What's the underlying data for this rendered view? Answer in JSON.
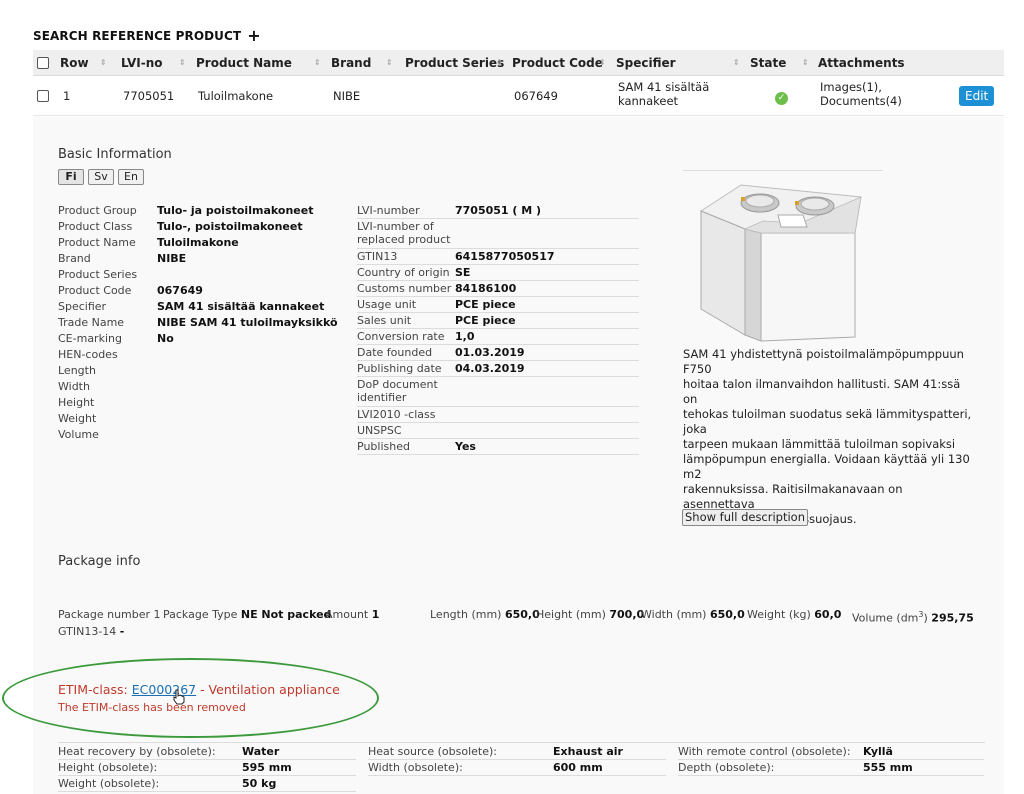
{
  "title": "SEARCH REFERENCE PRODUCT",
  "title_add": "+",
  "table": {
    "headers": [
      "Row",
      "LVI-no",
      "Product Name",
      "Brand",
      "Product Series",
      "Product Code",
      "Specifier",
      "State",
      "Attachments"
    ],
    "sort_glyph": "⇕",
    "row": {
      "row": "1",
      "lvi": "7705051",
      "name": "Tuloilmakone",
      "brand": "NIBE",
      "series": "",
      "code": "067649",
      "specifier_1": "SAM 41 sisältää",
      "specifier_2": "kannakeet",
      "state_glyph": "✓",
      "attach_1": "Images(1),",
      "attach_2": "Documents(4)",
      "edit": "Edit"
    }
  },
  "basic": {
    "heading": "Basic Information",
    "languages": [
      "Fi",
      "Sv",
      "En"
    ],
    "left": [
      {
        "k": "Product Group",
        "v": "Tulo- ja poistoilmakoneet"
      },
      {
        "k": "Product Class",
        "v": "Tulo-, poistoilmakoneet"
      },
      {
        "k": "Product Name",
        "v": "Tuloilmakone"
      },
      {
        "k": "Brand",
        "v": "NIBE"
      },
      {
        "k": "Product Series",
        "v": ""
      },
      {
        "k": "Product Code",
        "v": "067649"
      },
      {
        "k": "Specifier",
        "v": "SAM 41 sisältää kannakeet"
      },
      {
        "k": "Trade Name",
        "v": "NIBE SAM 41 tuloilmayksikkö"
      },
      {
        "k": "CE-marking",
        "v": "No"
      },
      {
        "k": "HEN-codes",
        "v": ""
      },
      {
        "k": "Length",
        "v": ""
      },
      {
        "k": "Width",
        "v": ""
      },
      {
        "k": "Height",
        "v": ""
      },
      {
        "k": "Weight",
        "v": ""
      },
      {
        "k": "Volume",
        "v": ""
      }
    ],
    "right": [
      {
        "k": "LVI-number",
        "v": "7705051 ( M )"
      },
      {
        "k": "LVI-number of",
        "k2": "replaced product",
        "v": ""
      },
      {
        "k": "GTIN13",
        "v": "6415877050517"
      },
      {
        "k": "Country of origin",
        "v": "SE"
      },
      {
        "k": "Customs number",
        "v": "84186100"
      },
      {
        "k": "Usage unit",
        "v": "PCE piece"
      },
      {
        "k": "Sales unit",
        "v": "PCE piece"
      },
      {
        "k": "Conversion rate",
        "v": "1,0"
      },
      {
        "k": "Date founded",
        "v": "01.03.2019"
      },
      {
        "k": "Publishing date",
        "v": "04.03.2019"
      },
      {
        "k": "DoP document",
        "k2": "identifier",
        "v": ""
      },
      {
        "k": "LVI2010 -class",
        "v": ""
      },
      {
        "k": "UNSPSC",
        "v": ""
      },
      {
        "k": "Published",
        "v": "Yes"
      }
    ],
    "description_lines": [
      "SAM 41 yhdistettynä poistoilmalämpöpumppuun F750",
      "hoitaa talon ilmanvaihdon hallitusti. SAM 41:ssä on",
      "tehokas tuloilman suodatus sekä lämmityspatteri, joka",
      "tarpeen mukaan lämmittää tuloilman sopivaksi",
      "lämpöpumpun energialla. Voidaan käyttää yli 130 m2",
      "rakennuksissa. Raitisilmakanavaan on asennettava",
      "ulkopuolinen jäätymissuojaus."
    ],
    "show_full": "Show full description"
  },
  "package": {
    "heading": "Package info",
    "number_label": "Package number",
    "number": "1",
    "type_label": "Package Type",
    "type": "NE Not packed",
    "amount_label": "Amount",
    "amount": "1",
    "length_label": "Length (mm)",
    "length": "650,0",
    "height_label": "Height (mm)",
    "height": "700,0",
    "width_label": "Width (mm)",
    "width": "650,0",
    "weight_label": "Weight (kg)",
    "weight": "60,0",
    "volume_label": "Volume (dm",
    "volume_sup": "3",
    "volume_close": ")",
    "volume": "295,75",
    "gtin_label": "GTIN13-14",
    "gtin": "-"
  },
  "etim": {
    "prefix": "ETIM-class:",
    "code": "EC000267",
    "name": "- Ventilation appliance",
    "removed": "The ETIM-class has been removed"
  },
  "obsolete": [
    {
      "k": "Heat recovery by (obsolete):",
      "v": "Water"
    },
    {
      "k": "Heat source (obsolete):",
      "v": "Exhaust air"
    },
    {
      "k": "With remote control (obsolete):",
      "v": "Kyllä"
    },
    {
      "k": "Height (obsolete):",
      "v": "595 mm"
    },
    {
      "k": "Width (obsolete):",
      "v": "600 mm"
    },
    {
      "k": "Depth (obsolete):",
      "v": "555 mm"
    },
    {
      "k": "Weight (obsolete):",
      "v": "50 kg"
    }
  ],
  "colors": {
    "accent": "#1e90d6",
    "ok": "#6cbf4b",
    "error": "#c0392b",
    "link": "#1a6fb4",
    "highlight_ellipse": "#3c9a3c"
  }
}
